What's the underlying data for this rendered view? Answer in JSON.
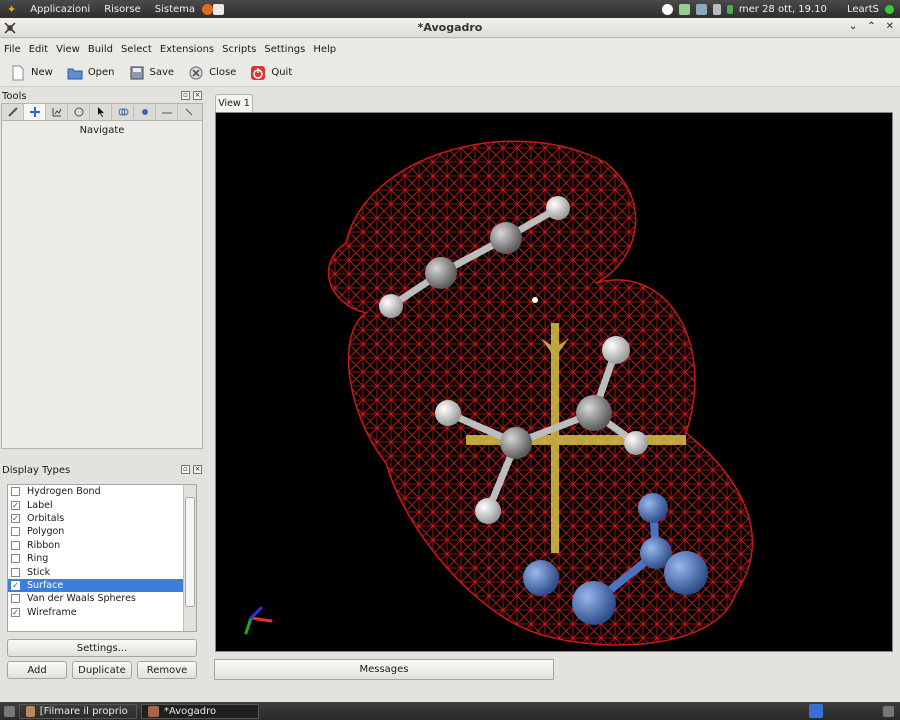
{
  "system_panel": {
    "menus": [
      "Applicazioni",
      "Risorse",
      "Sistema"
    ],
    "clock": "mer 28 ott, 19.10",
    "user": "LeartS"
  },
  "window": {
    "title": "*Avogadro"
  },
  "menubar": [
    "File",
    "Edit",
    "View",
    "Build",
    "Select",
    "Extensions",
    "Scripts",
    "Settings",
    "Help"
  ],
  "toolbar": {
    "new_label": "New",
    "open_label": "Open",
    "save_label": "Save",
    "close_label": "Close",
    "quit_label": "Quit"
  },
  "tools": {
    "title": "Tools",
    "tab_icons": [
      "draw-tool-icon",
      "navigate-tool-icon",
      "bond-centric-icon",
      "manipulate-icon",
      "select-icon",
      "auto-rotate-icon",
      "auto-optimize-icon",
      "measure-icon",
      "align-icon"
    ],
    "active_label": "Navigate"
  },
  "display_types": {
    "title": "Display Types",
    "items": [
      {
        "label": "Hydrogen Bond",
        "checked": false
      },
      {
        "label": "Label",
        "checked": true
      },
      {
        "label": "Orbitals",
        "checked": true
      },
      {
        "label": "Polygon",
        "checked": false
      },
      {
        "label": "Ribbon",
        "checked": false
      },
      {
        "label": "Ring",
        "checked": false
      },
      {
        "label": "Stick",
        "checked": false
      },
      {
        "label": "Surface",
        "checked": true,
        "selected": true
      },
      {
        "label": "Van der Waals Spheres",
        "checked": false
      },
      {
        "label": "Wireframe",
        "checked": true
      }
    ],
    "settings_label": "Settings...",
    "add_label": "Add",
    "duplicate_label": "Duplicate",
    "remove_label": "Remove"
  },
  "view": {
    "tab_label": "View 1",
    "messages_label": "Messages"
  },
  "taskbar": {
    "tasks": [
      "[Filmare il proprio de...",
      "*Avogadro"
    ]
  },
  "colors": {
    "surface_mesh": "#c81e1e",
    "hydrogen": "#e8e8e8",
    "carbon": "#808080",
    "nitrogen": "#4a74c0",
    "orbital_axes": "#e0cc50",
    "selection": "#3d7fd8"
  }
}
